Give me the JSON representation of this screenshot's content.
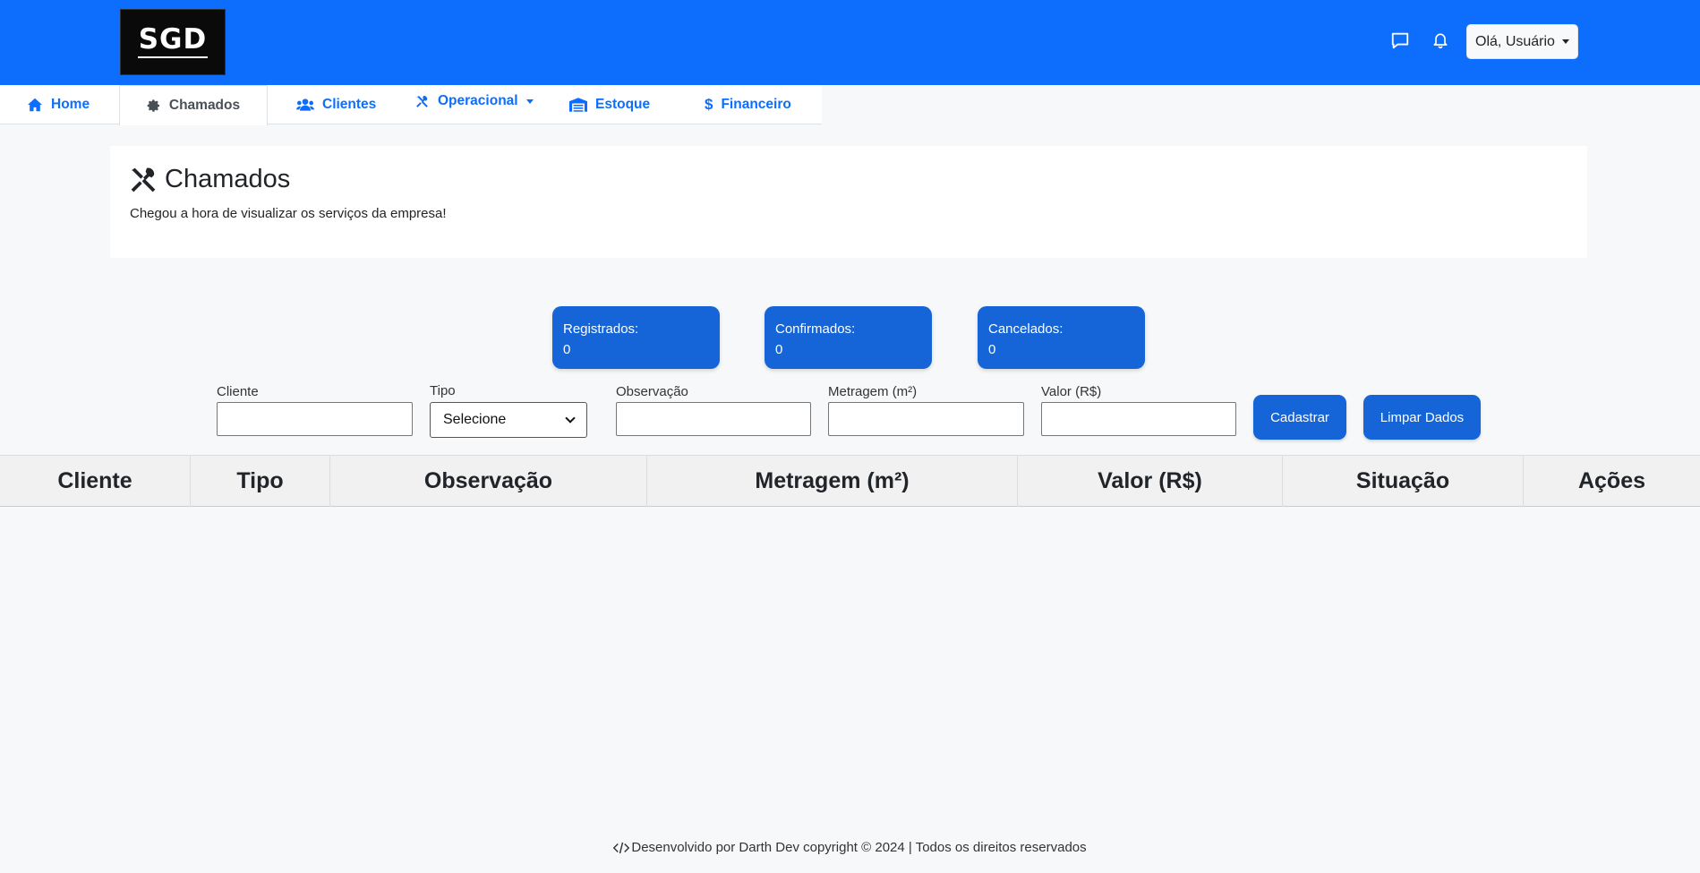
{
  "header": {
    "logo_text": "SGD",
    "user_menu_label": "Olá, Usuário",
    "icons": [
      "chat-icon",
      "bell-icon"
    ],
    "brand_color": "#0d6efd"
  },
  "tabs": [
    {
      "label": "Home",
      "icon": "home-icon",
      "active": false
    },
    {
      "label": "Chamados",
      "icon": "gear-icon",
      "active": true
    },
    {
      "label": "Clientes",
      "icon": "users-icon",
      "active": false
    },
    {
      "label": "Operacional",
      "icon": "tools-icon",
      "active": false,
      "dropdown": true
    },
    {
      "label": "Estoque",
      "icon": "warehouse-icon",
      "active": false
    },
    {
      "label": "Financeiro",
      "icon": "dollar-icon",
      "active": false
    }
  ],
  "page": {
    "title": "Chamados",
    "subtitle": "Chegou a hora de visualizar os serviços da empresa!"
  },
  "stats": [
    {
      "label": "Registrados:",
      "value": "0"
    },
    {
      "label": "Confirmados:",
      "value": "0"
    },
    {
      "label": "Cancelados:",
      "value": "0"
    }
  ],
  "form": {
    "cliente_label": "Cliente",
    "cliente_value": "",
    "tipo_label": "Tipo",
    "tipo_selected": "Selecione",
    "observacao_label": "Observação",
    "observacao_value": "",
    "metragem_label": "Metragem (m²)",
    "metragem_value": "",
    "valor_label": "Valor (R$)",
    "valor_value": "",
    "submit_label": "Cadastrar",
    "clear_label": "Limpar Dados"
  },
  "table": {
    "columns": [
      "Cliente",
      "Tipo",
      "Observação",
      "Metragem (m²)",
      "Valor (R$)",
      "Situação",
      "Ações"
    ],
    "rows": []
  },
  "footer": {
    "text": "Desenvolvido por Darth Dev copyright © 2024 | Todos os direitos reservados",
    "icon": "code-icon"
  }
}
